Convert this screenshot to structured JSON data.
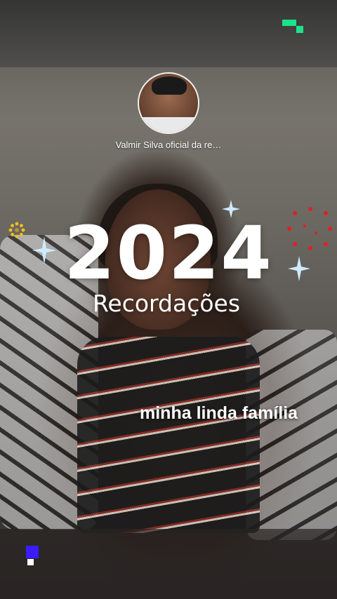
{
  "profile": {
    "name": "Valmir Silva oficial da re…"
  },
  "memories": {
    "year": "2024",
    "subtitle": "Recordações"
  },
  "caption": "minha linda família",
  "icons": {
    "brand_top_right": "green-pixel-logo-icon",
    "brand_bottom_left": "blue-pixel-badge-icon",
    "decor": [
      "sparkle-icon",
      "sun-icon",
      "red-dots-icon"
    ]
  },
  "colors": {
    "brand_green": "#1be38a",
    "badge_blue": "#3b1bff",
    "sparkle": "#bfe6ff",
    "sun": "#f3c11b",
    "dots": "#e02020"
  }
}
